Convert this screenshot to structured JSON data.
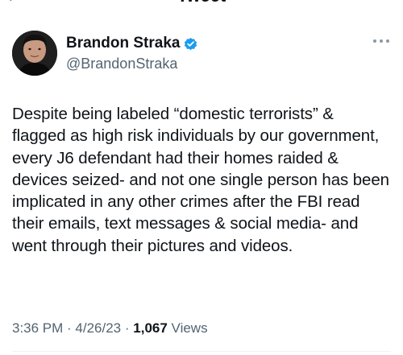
{
  "header": {
    "title": "Tweet",
    "back_glyph": "‹"
  },
  "author": {
    "display_name": "Brandon Straka",
    "handle": "@BrandonStraka",
    "verified": true,
    "verified_color": "#1d9bf0",
    "avatar_icon": "avatar-portrait"
  },
  "tweet": {
    "text": "Despite being labeled “domestic terrorists” & flagged as high risk individuals by our government, every J6 defendant had their homes raided & devices seized- and not one single person has been implicated in any other crimes after the FBI read their emails, text messages & social media- and went through their pictures and videos."
  },
  "meta": {
    "time": "3:36 PM",
    "separator": " · ",
    "date": "4/26/23",
    "views_count": "1,067",
    "views_label": "Views"
  },
  "colors": {
    "text_primary": "#0f1419",
    "text_secondary": "#536471",
    "divider": "#eff3f4"
  }
}
